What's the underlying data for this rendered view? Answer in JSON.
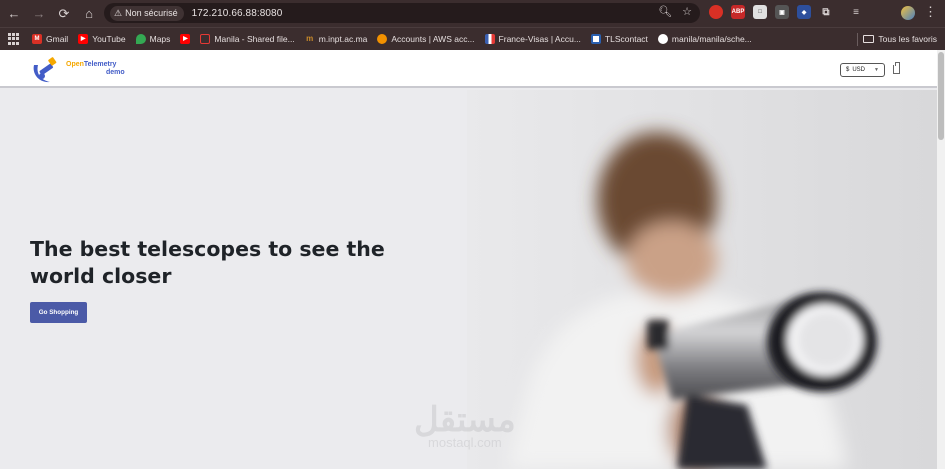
{
  "browser": {
    "security_label": "Non sécurisé",
    "url": "172.210.66.88:8080",
    "bookmarks": [
      {
        "label": "Gmail",
        "color": "#d93025",
        "icon": "gmail-icon"
      },
      {
        "label": "YouTube",
        "color": "#ff0000",
        "icon": "youtube-icon"
      },
      {
        "label": "Maps",
        "color": "#34a853",
        "icon": "maps-icon"
      },
      {
        "label": "",
        "color": "#ff0000",
        "icon": "youtube-icon"
      },
      {
        "label": "Manila - Shared file...",
        "color": "#e53935",
        "icon": "file-icon"
      },
      {
        "label": "m.inpt.ac.ma",
        "color": "#c88a2a",
        "icon": "moodle-icon"
      },
      {
        "label": "Accounts | AWS acc...",
        "color": "#f29100",
        "icon": "aws-icon"
      },
      {
        "label": "France-Visas | Accu...",
        "color": "#3a5fb0",
        "icon": "france-visas-icon"
      },
      {
        "label": "TLScontact",
        "color": "#2a60b0",
        "icon": "tlscontact-icon"
      },
      {
        "label": "manila/manila/sche...",
        "color": "#ffffff",
        "icon": "github-icon"
      }
    ],
    "all_bookmarks_label": "Tous les favoris"
  },
  "site": {
    "logo_line1_a": "Open",
    "logo_line1_b": "Telemetry",
    "logo_line2": "demo",
    "currency": "USD",
    "currency_symbol": "$",
    "headline": "The best telescopes to see the world closer",
    "cta_label": "Go Shopping"
  },
  "watermark": {
    "arabic": "مستقل",
    "latin": "mostaql.com"
  }
}
